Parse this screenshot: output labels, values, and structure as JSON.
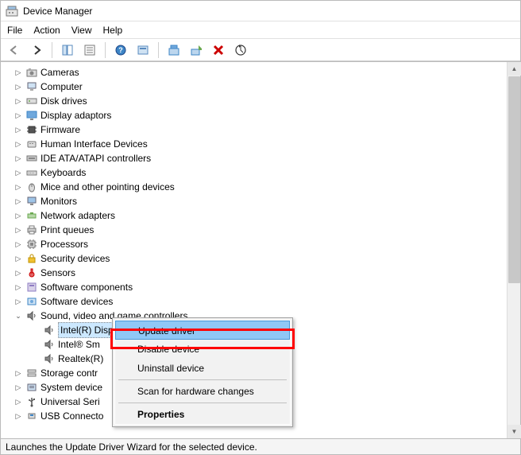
{
  "window": {
    "title": "Device Manager"
  },
  "menu": {
    "file": "File",
    "action": "Action",
    "view": "View",
    "help": "Help"
  },
  "tree": {
    "cameras": "Cameras",
    "computer": "Computer",
    "disk": "Disk drives",
    "display": "Display adaptors",
    "firmware": "Firmware",
    "hid": "Human Interface Devices",
    "ide": "IDE ATA/ATAPI controllers",
    "keyboards": "Keyboards",
    "mice": "Mice and other pointing devices",
    "monitors": "Monitors",
    "netadapters": "Network adapters",
    "printq": "Print queues",
    "processors": "Processors",
    "security": "Security devices",
    "sensors": "Sensors",
    "swcomp": "Software components",
    "swdev": "Software devices",
    "sound": "Sound, video and game controllers",
    "sound_children": {
      "intel_display": "Intel(R) Display Audio",
      "intel_sm": "Intel® Sm",
      "realtek": "Realtek(R)"
    },
    "storage": "Storage contr",
    "sysdev": "System device",
    "usb_serial": "Universal Seri",
    "usb_conn": "USB Connecto"
  },
  "context_menu": {
    "update": "Update driver",
    "disable": "Disable device",
    "uninstall": "Uninstall device",
    "scan": "Scan for hardware changes",
    "properties": "Properties"
  },
  "status": "Launches the Update Driver Wizard for the selected device."
}
